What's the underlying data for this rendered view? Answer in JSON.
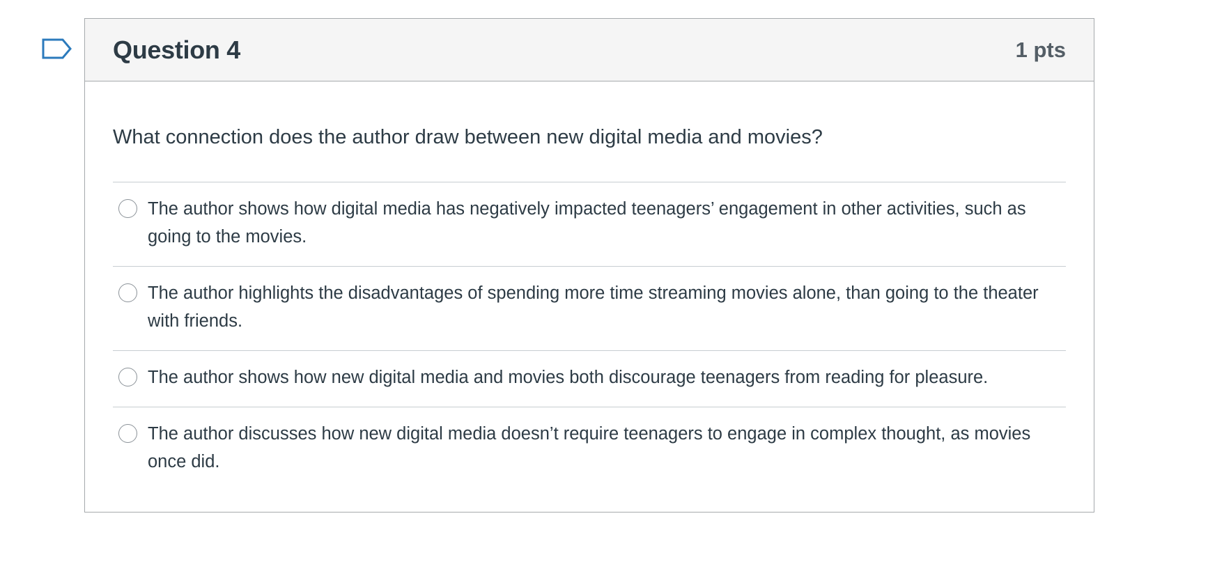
{
  "question": {
    "title": "Question 4",
    "points": "1 pts",
    "text": "What connection does the author draw between new digital media and movies?",
    "answers": [
      {
        "label": "The author shows how digital media has negatively impacted teenagers’ engagement in other activities, such as going to the movies.",
        "selected": false
      },
      {
        "label": "The author highlights the disadvantages of spending more time streaming movies alone, than going to the theater with friends.",
        "selected": false
      },
      {
        "label": "The author shows how new digital media and movies both discourage teenagers from reading for pleasure.",
        "selected": false
      },
      {
        "label": "The author discusses how new digital media doesn’t require teenagers to engage in complex thought, as movies once did.",
        "selected": false
      }
    ]
  },
  "icons": {
    "flag": "flag-question-icon",
    "radio": "radio-unselected-icon"
  },
  "colors": {
    "text": "#2d3b45",
    "header_bg": "#f5f5f5",
    "border": "#a5a9ac",
    "divider": "#c7cdd1",
    "flag": "#2b7abc"
  }
}
